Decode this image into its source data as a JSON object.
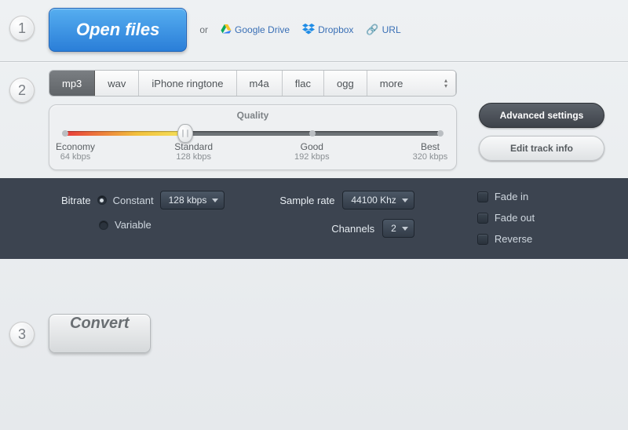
{
  "steps": {
    "one": "1",
    "two": "2",
    "three": "3"
  },
  "open": {
    "button": "Open files",
    "or": "or",
    "google_drive": "Google Drive",
    "dropbox": "Dropbox",
    "url": "URL"
  },
  "formats": {
    "tabs": [
      "mp3",
      "wav",
      "iPhone ringtone",
      "m4a",
      "flac",
      "ogg",
      "more"
    ],
    "active_index": 0
  },
  "quality": {
    "title": "Quality",
    "levels": [
      {
        "name": "Economy",
        "bitrate": "64 kbps"
      },
      {
        "name": "Standard",
        "bitrate": "128 kbps"
      },
      {
        "name": "Good",
        "bitrate": "192 kbps"
      },
      {
        "name": "Best",
        "bitrate": "320 kbps"
      }
    ],
    "selected_index": 1
  },
  "side": {
    "advanced": "Advanced settings",
    "edit_track": "Edit track info"
  },
  "advanced": {
    "bitrate_label": "Bitrate",
    "constant": "Constant",
    "variable": "Variable",
    "bitrate_value": "128 kbps",
    "sample_rate_label": "Sample rate",
    "sample_rate_value": "44100 Khz",
    "channels_label": "Channels",
    "channels_value": "2",
    "fade_in": "Fade in",
    "fade_out": "Fade out",
    "reverse": "Reverse"
  },
  "convert": {
    "button": "Convert"
  }
}
